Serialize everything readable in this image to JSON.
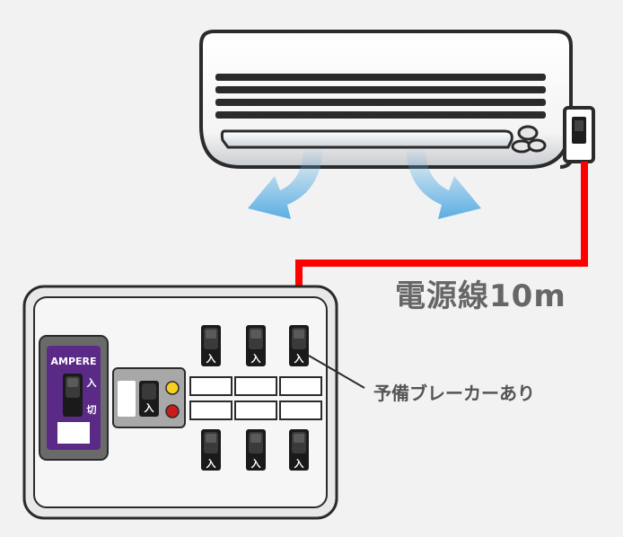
{
  "labels": {
    "cable_length": "電源線10m",
    "spare_breaker": "予備ブレーカーあり"
  },
  "main_breaker": {
    "brand": "AMPERE",
    "on_label": "入",
    "off_label": "切"
  },
  "leak_breaker": {
    "on_label": "入"
  },
  "branch_breakers": {
    "on_label": "入"
  },
  "colors": {
    "cable": "#ff0000",
    "airflow": "#5aaee4",
    "main_breaker_panel": "#5b2a86",
    "indicator_yellow": "#f5d020",
    "indicator_red": "#cc1a1a"
  },
  "icons": [
    "air-conditioner-icon",
    "airflow-arrow-icon",
    "wall-outlet-icon",
    "breaker-switch-icon"
  ]
}
